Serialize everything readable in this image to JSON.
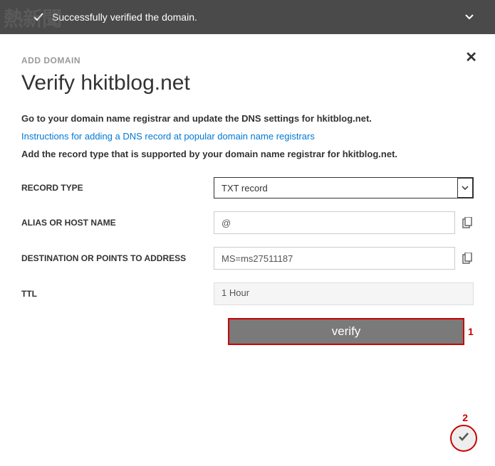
{
  "watermark": "熱新聞",
  "notification": {
    "message": "Successfully verified the domain."
  },
  "breadcrumb": "ADD DOMAIN",
  "title": "Verify hkitblog.net",
  "instructions": {
    "line1": "Go to your domain name registrar and update the DNS settings for hkitblog.net.",
    "link": "Instructions for adding a DNS record at popular domain name registrars",
    "line2": "Add the record type that is supported by your domain name registrar for hkitblog.net."
  },
  "form": {
    "record_type": {
      "label": "RECORD TYPE",
      "value": "TXT record"
    },
    "alias": {
      "label": "ALIAS OR HOST NAME",
      "value": "@"
    },
    "destination": {
      "label": "DESTINATION OR POINTS TO ADDRESS",
      "value": "MS=ms27511187"
    },
    "ttl": {
      "label": "TTL",
      "value": "1 Hour"
    }
  },
  "buttons": {
    "verify": "verify"
  },
  "annotations": {
    "one": "1",
    "two": "2"
  }
}
